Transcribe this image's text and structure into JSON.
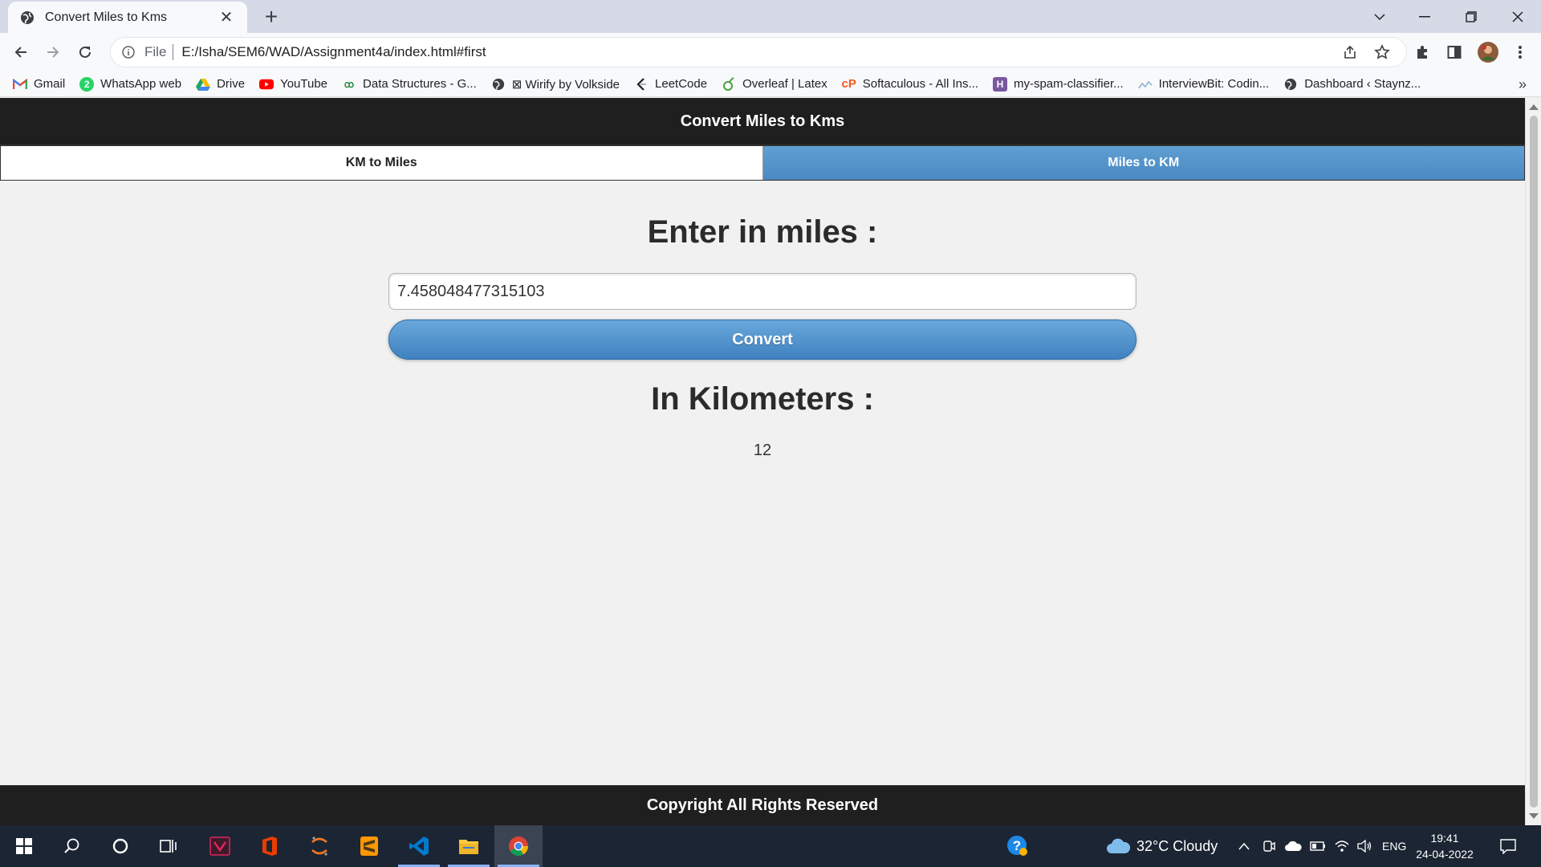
{
  "browser": {
    "tab_title": "Convert Miles to Kms",
    "tab_close": "✕",
    "new_tab": "+",
    "url_scheme": "File",
    "url": "E:/Isha/SEM6/WAD/Assignment4a/index.html#first",
    "bookmarks": [
      {
        "label": "Gmail",
        "icon": "gmail-icon"
      },
      {
        "label": "WhatsApp web",
        "icon": "whatsapp-icon"
      },
      {
        "label": "Drive",
        "icon": "drive-icon"
      },
      {
        "label": "YouTube",
        "icon": "youtube-icon"
      },
      {
        "label": "Data Structures - G...",
        "icon": "data-structures-icon"
      },
      {
        "label": "⊠ Wirify by Volkside",
        "icon": "globe-icon"
      },
      {
        "label": "LeetCode",
        "icon": "leetcode-icon"
      },
      {
        "label": "Overleaf | Latex",
        "icon": "overleaf-icon"
      },
      {
        "label": "Softaculous - All Ins...",
        "icon": "softaculous-icon"
      },
      {
        "label": "my-spam-classifier...",
        "icon": "heroku-icon"
      },
      {
        "label": "InterviewBit: Codin...",
        "icon": "interviewbit-icon"
      },
      {
        "label": "Dashboard ‹ Staynz...",
        "icon": "globe-icon"
      }
    ],
    "bookmarks_more": "»"
  },
  "page": {
    "header_title": "Convert Miles to Kms",
    "tabs": [
      {
        "label": "KM to Miles",
        "active": false
      },
      {
        "label": "Miles to KM",
        "active": true
      }
    ],
    "input_heading": "Enter in miles :",
    "input_value": "7.458048477315103",
    "convert_label": "Convert",
    "output_heading": "In Kilometers :",
    "output_value": "12",
    "footer_text": "Copyright All Rights Reserved",
    "accent_color": "#4a89c2"
  },
  "taskbar": {
    "weather": "32°C  Cloudy",
    "language": "ENG",
    "time": "19:41",
    "date": "24-04-2022"
  }
}
